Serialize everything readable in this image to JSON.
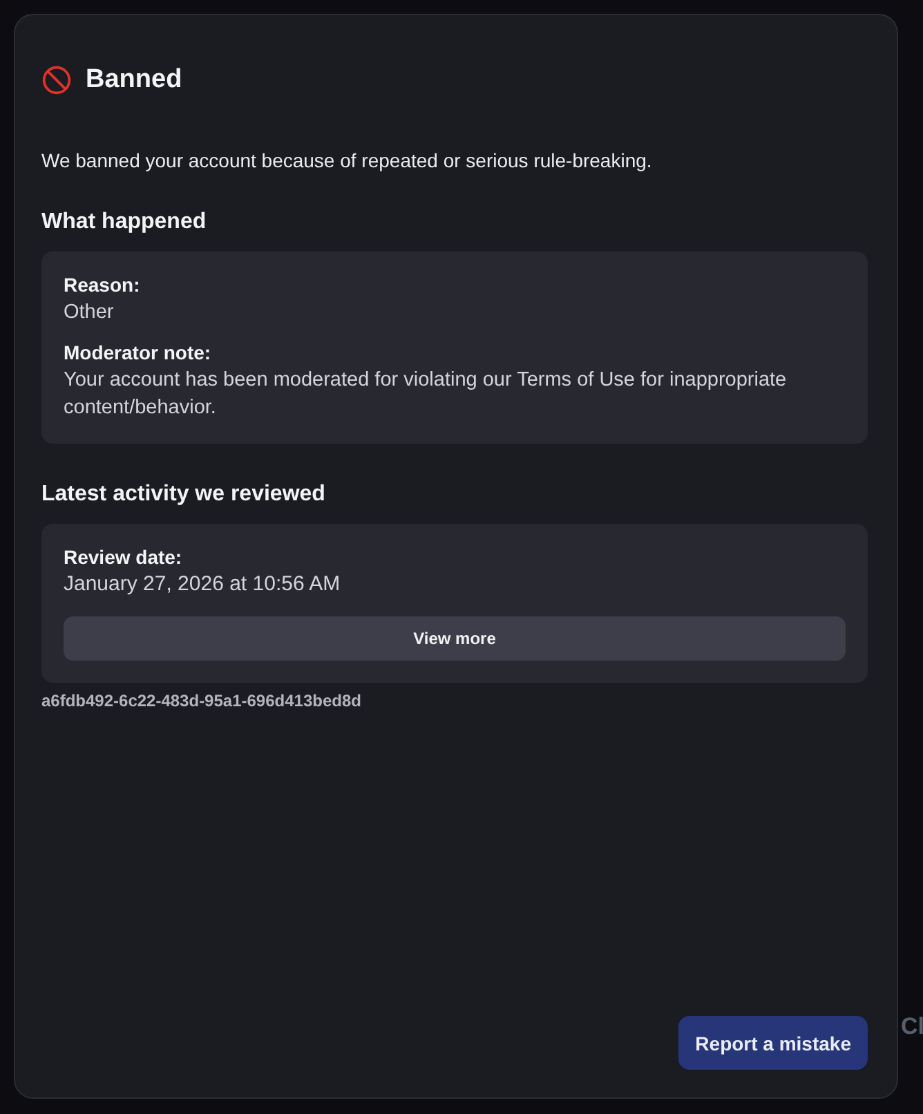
{
  "background_text": "Cl",
  "dialog": {
    "title": "Banned",
    "message": "We banned your account because of repeated or serious rule-breaking.",
    "sections": [
      {
        "heading": "What happened",
        "fields": [
          {
            "label": "Reason:",
            "value": "Other"
          },
          {
            "label": "Moderator note:",
            "value": "Your account has been moderated for violating our Terms of Use for inappropriate content/behavior."
          }
        ]
      },
      {
        "heading": "Latest activity we reviewed",
        "fields": [
          {
            "label": "Review date:",
            "value": "January 27, 2026 at 10:56 AM"
          }
        ],
        "button": "View more"
      }
    ],
    "reference_id": "a6fdb492-6c22-483d-95a1-696d413bed8d",
    "action_button": "Report a mistake"
  }
}
